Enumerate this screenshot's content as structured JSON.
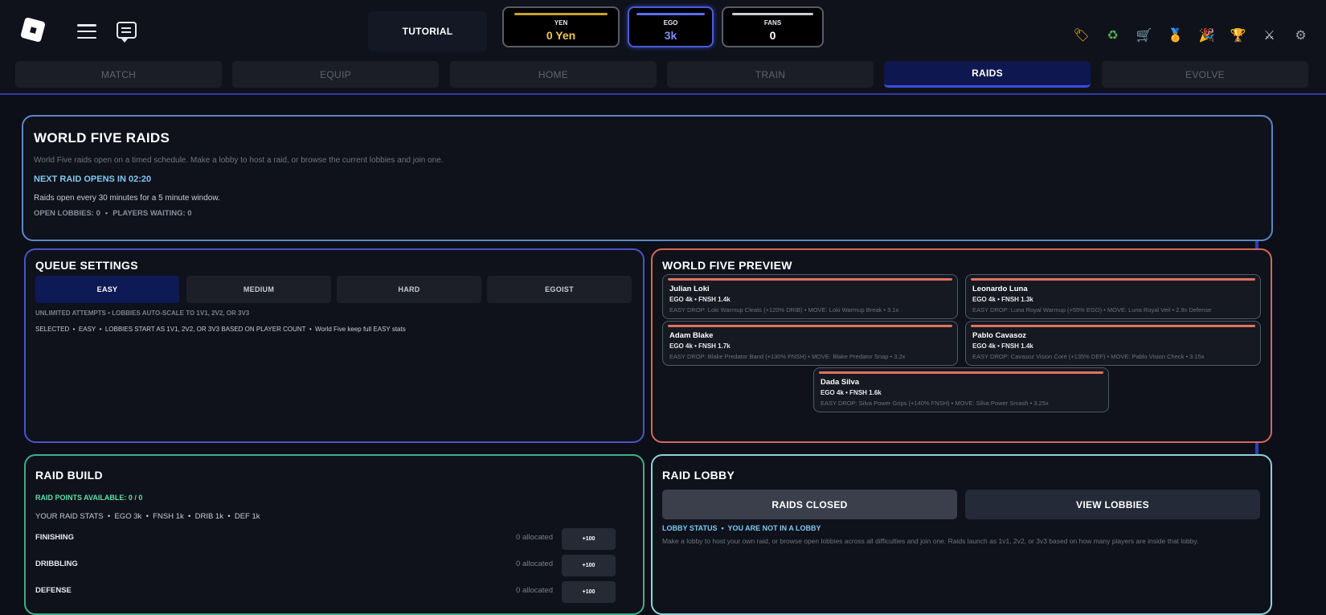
{
  "topbar": {
    "tutorial_label": "TUTORIAL",
    "stats": [
      {
        "label": "YEN",
        "value": "0 Yen",
        "bar_color": "#c9a227",
        "value_color": "#f3c744"
      },
      {
        "label": "EGO",
        "value": "3k",
        "bar_color": "#5a6cf0",
        "value_color": "#7f8ffb"
      },
      {
        "label": "FANS",
        "value": "0",
        "bar_color": "#c9ccd3",
        "value_color": "#ffffff"
      }
    ],
    "right_icons": [
      "tag-icon",
      "recycle-icon",
      "cart-icon",
      "medal-icon",
      "party-popper-icon",
      "trophy-icon",
      "crossed-swords-icon",
      "gear-icon"
    ]
  },
  "tabs": [
    {
      "label": "MATCH",
      "active": false
    },
    {
      "label": "EQUIP",
      "active": false
    },
    {
      "label": "HOME",
      "active": false
    },
    {
      "label": "TRAIN",
      "active": false
    },
    {
      "label": "RAIDS",
      "active": true
    },
    {
      "label": "EVOLVE",
      "active": false
    }
  ],
  "header": {
    "title": "WORLD FIVE RAIDS",
    "description": "World Five raids open on a timed schedule. Make a lobby to host a raid, or browse the current lobbies and join one.",
    "next_raid": "NEXT RAID OPENS IN 02:20",
    "schedule": "Raids open every 30 minutes for a 5 minute window.",
    "open_lobbies": "OPEN LOBBIES: 0",
    "separator": "•",
    "players_waiting": "PLAYERS WAITING: 0"
  },
  "queue": {
    "title": "QUEUE SETTINGS",
    "difficulties": [
      {
        "label": "EASY",
        "selected": true
      },
      {
        "label": "MEDIUM",
        "selected": false
      },
      {
        "label": "HARD",
        "selected": false
      },
      {
        "label": "EGOIST",
        "selected": false
      }
    ],
    "info_line": "UNLIMITED ATTEMPTS  •  LOBBIES AUTO-SCALE TO 1V1, 2V2, OR 3V3",
    "selected_line": "SELECTED  •  EASY  •  LOBBIES START AS 1V1, 2V2, OR 3V3 BASED ON PLAYER COUNT  •  World Five keep full EASY stats"
  },
  "preview": {
    "title": "WORLD FIVE PREVIEW",
    "players": [
      {
        "name": "Julian Loki",
        "stats": "EGO 4k  •  FNSH 1.4k",
        "drop": "EASY DROP: Loki Warmup Cleats  (+120% DRIB)  •  MOVE: Loki Warmup Break  •  3.1x"
      },
      {
        "name": "Leonardo Luna",
        "stats": "EGO 4k  •  FNSH 1.3k",
        "drop": "EASY DROP: Luna Royal Warmup  (+55% EGO)  •  MOVE: Luna Royal Veil  •  2.9x Defense"
      },
      {
        "name": "Adam Blake",
        "stats": "EGO 4k  •  FNSH 1.7k",
        "drop": "EASY DROP: Blake Predator Band  (+130% FNSH)  •  MOVE: Blake Predator Snap  •  3.2x"
      },
      {
        "name": "Pablo Cavasoz",
        "stats": "EGO 4k  •  FNSH 1.4k",
        "drop": "EASY DROP: Cavasoz Vision Core  (+135% DEF)  •  MOVE: Pablo Vision Check  •  3.15x"
      },
      {
        "name": "Dada Silva",
        "stats": "EGO 4k  •  FNSH 1.6k",
        "drop": "EASY DROP: Silva Power Grips  (+140% FNSH)  •  MOVE: Silva Power Smash  •  3.25x"
      }
    ]
  },
  "build": {
    "title": "RAID BUILD",
    "points": "RAID POINTS AVAILABLE: 0 / 0",
    "stats_line": "YOUR RAID STATS  •  EGO 3k  •  FNSH 1k  •  DRIB 1k  •  DEF 1k",
    "rows": [
      {
        "label": "FINISHING",
        "allocated": "0 allocated",
        "button": "+100"
      },
      {
        "label": "DRIBBLING",
        "allocated": "0 allocated",
        "button": "+100"
      },
      {
        "label": "DEFENSE",
        "allocated": "0 allocated",
        "button": "+100"
      }
    ]
  },
  "lobby": {
    "title": "RAID LOBBY",
    "closed_button": "RAIDS CLOSED",
    "view_button": "VIEW LOBBIES",
    "status": "LOBBY STATUS  •  YOU ARE NOT IN A LOBBY",
    "description": "Make a lobby to host your own raid, or browse open lobbies across all difficulties and join one. Raids launch as 1v1, 2v2, or 3v3 based on how many players are inside that lobby."
  }
}
